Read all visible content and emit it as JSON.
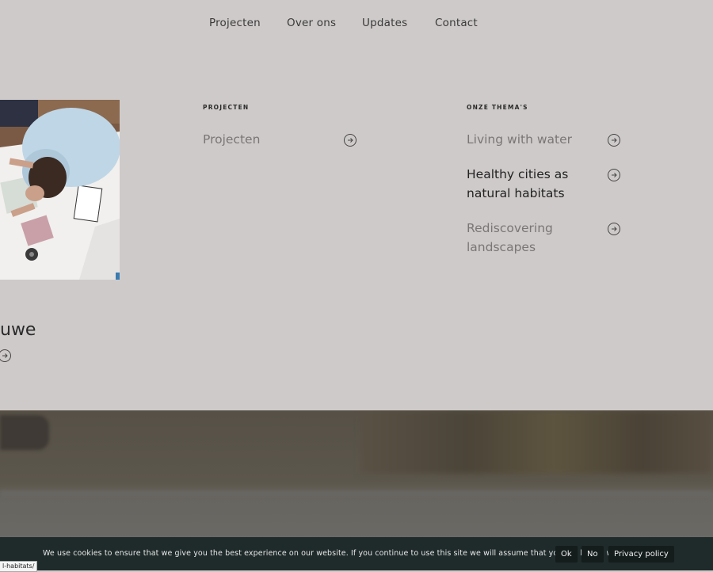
{
  "nav": {
    "items": [
      {
        "label": "Projecten"
      },
      {
        "label": "Over ons"
      },
      {
        "label": "Updates"
      },
      {
        "label": "Contact"
      }
    ]
  },
  "menu": {
    "projects": {
      "title": "PROJECTEN",
      "items": [
        {
          "label": "Projecten"
        }
      ]
    },
    "themes": {
      "title": "ONZE THEMA'S",
      "items": [
        {
          "label": "Living with water"
        },
        {
          "label": "Healthy cities as natural habitats"
        },
        {
          "label": "Rediscovering landscapes"
        }
      ]
    }
  },
  "partial_heading": "uwe",
  "cookie": {
    "message": "We use cookies to ensure that we give you the best experience on our website. If you continue to use this site we will assume that you are happy with it.",
    "ok_label": "Ok",
    "no_label": "No",
    "privacy_label": "Privacy policy"
  },
  "status_url": "l-habitats/",
  "colors": {
    "background": "#cfcaca",
    "active_text": "#222222",
    "inactive_text": "#7a7676",
    "cookie_bar": "#1f2a2a"
  }
}
